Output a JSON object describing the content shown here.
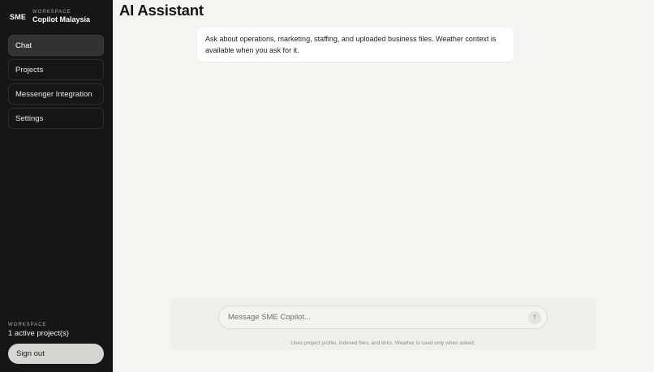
{
  "sidebar": {
    "brand_mark": "SME",
    "brand_kicker": "WORKSPACE",
    "brand_name": "Copilot Malaysia",
    "nav": [
      {
        "label": "Chat",
        "active": true
      },
      {
        "label": "Projects",
        "active": false
      },
      {
        "label": "Messenger Integration",
        "active": false
      },
      {
        "label": "Settings",
        "active": false
      }
    ],
    "workspace_kicker": "WORKSPACE",
    "workspace_value": "1 active project(s)",
    "signout_label": "Sign out"
  },
  "main": {
    "title": "AI Assistant",
    "assistant_message": "Ask about operations, marketing, staffing, and uploaded business files. Weather context is available when you ask for it.",
    "composer": {
      "placeholder": "Message SME Copilot...",
      "value": "",
      "send_icon": "arrow-up-icon",
      "hint": "Uses project profile, indexed files, and links. Weather is used only when asked."
    }
  }
}
